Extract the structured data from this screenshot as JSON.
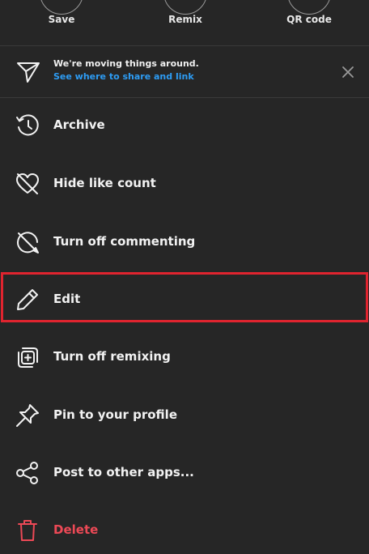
{
  "top_actions": [
    {
      "label": "Save",
      "icon": "bookmark-icon"
    },
    {
      "label": "Remix",
      "icon": "remix-icon"
    },
    {
      "label": "QR code",
      "icon": "qr-code-icon"
    }
  ],
  "notice": {
    "icon": "paper-plane-icon",
    "title": "We're moving things around.",
    "link": "See where to share and link",
    "link_color": "#2d9cf4",
    "close_icon": "close-icon"
  },
  "menu": [
    {
      "label": "Archive",
      "icon": "archive-clock-icon"
    },
    {
      "label": "Hide like count",
      "icon": "heart-off-icon"
    },
    {
      "label": "Turn off commenting",
      "icon": "comment-off-icon"
    },
    {
      "label": "Edit",
      "icon": "pencil-icon"
    },
    {
      "label": "Turn off remixing",
      "icon": "remix-off-icon"
    },
    {
      "label": "Pin to your profile",
      "icon": "pin-icon"
    },
    {
      "label": "Post to other apps...",
      "icon": "share-icon"
    },
    {
      "label": "Delete",
      "icon": "trash-icon"
    }
  ],
  "colors": {
    "background": "#262626",
    "text": "#f2f2f2",
    "danger": "#ed4956",
    "highlight": "#e0242f"
  }
}
